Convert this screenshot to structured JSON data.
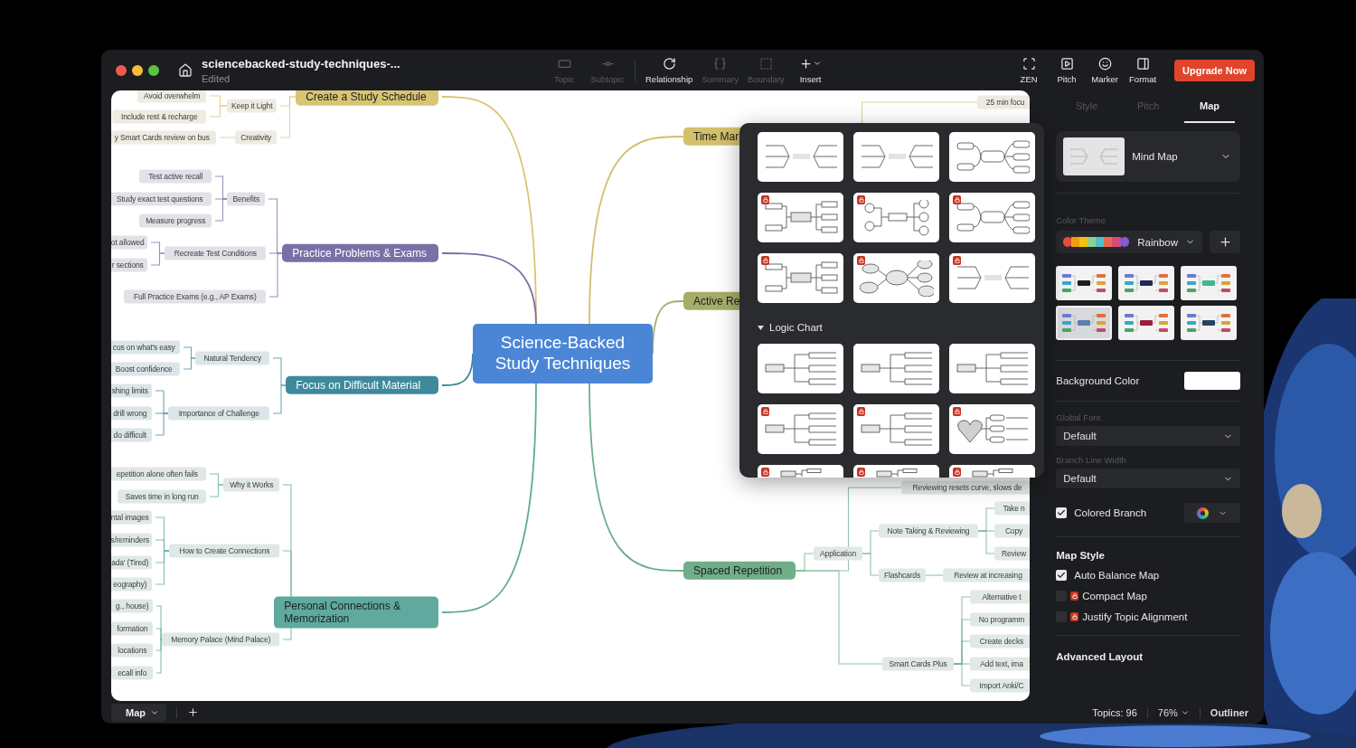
{
  "window": {
    "title": "sciencebacked-study-techniques-...",
    "subtitle": "Edited"
  },
  "toolbar": [
    {
      "label": "Topic",
      "disabled": true
    },
    {
      "label": "Subtopic",
      "disabled": true
    },
    {
      "label": "Relationship",
      "disabled": false
    },
    {
      "label": "Summary",
      "disabled": true
    },
    {
      "label": "Boundary",
      "disabled": true
    },
    {
      "label": "Insert",
      "disabled": false
    }
  ],
  "view_tools": [
    {
      "label": "ZEN"
    },
    {
      "label": "Pitch"
    },
    {
      "label": "Marker"
    },
    {
      "label": "Format"
    }
  ],
  "upgrade_button": "Upgrade Now",
  "map": {
    "topic": "Science-Backed Study Techniques",
    "branches": [
      {
        "text": "Create a Study Schedule",
        "color": "#d8c574",
        "children": [
          {
            "text": "Keep it Light",
            "children": [
              {
                "text": "Avoid overwhelm"
              },
              {
                "text": "Include rest & recharge"
              }
            ]
          },
          {
            "text": "Creativity",
            "children": [
              {
                "text": "y Smart Cards review on bus"
              }
            ]
          }
        ]
      },
      {
        "text": "Practice Problems & Exams",
        "color": "#7a6fa6",
        "children": [
          {
            "text": "Benefits",
            "children": [
              {
                "text": "Test active recall"
              },
              {
                "text": "Study exact test questions"
              },
              {
                "text": "Measure progress"
              }
            ]
          },
          {
            "text": "Recreate Test Conditions",
            "children": [
              {
                "text": "ot allowed"
              },
              {
                "text": "r sections"
              }
            ]
          },
          {
            "text": "Full Practice Exams (e.g., AP Exams)"
          }
        ]
      },
      {
        "text": "Focus on Difficult Material",
        "color": "#3e8a9c",
        "children": [
          {
            "text": "Natural Tendency",
            "children": [
              {
                "text": "cus on what's easy"
              },
              {
                "text": "Boost confidence"
              }
            ]
          },
          {
            "text": "Importance of Challenge",
            "children": [
              {
                "text": "shing limits"
              },
              {
                "text": "drill wrong"
              },
              {
                "text": "do difficult"
              }
            ]
          }
        ]
      },
      {
        "text": "Personal Connections & Memorization",
        "color": "#5fa99f",
        "children": [
          {
            "text": "Why it Works",
            "children": [
              {
                "text": "epetition alone often fails"
              },
              {
                "text": "Saves time in long run"
              }
            ]
          },
          {
            "text": "How to Create Connections",
            "children": [
              {
                "text": "ntal images"
              },
              {
                "text": "s/reminders"
              },
              {
                "text": "ada' (Tired)"
              },
              {
                "text": "eography)"
              }
            ]
          },
          {
            "text": "Memory Palace (Mind Palace)",
            "children": [
              {
                "text": "g., house)"
              },
              {
                "text": "formation"
              },
              {
                "text": "locations"
              },
              {
                "text": "ecall info"
              }
            ]
          }
        ]
      },
      {
        "text": "Time Mar",
        "color": "#d3bf6c",
        "children": [
          {
            "text": "25 min focu"
          }
        ]
      },
      {
        "text": "Active Re",
        "color": "#a6ac69"
      },
      {
        "text": "Spaced Repetition",
        "color": "#6fae89",
        "children": [
          {
            "text": "Reviewing resets curve, slows de"
          },
          {
            "text": "Application",
            "children": [
              {
                "text": "Note Taking & Reviewing",
                "children": [
                  {
                    "text": "Take n"
                  },
                  {
                    "text": "Copy"
                  },
                  {
                    "text": "Review"
                  }
                ]
              },
              {
                "text": "Flashcards",
                "children": [
                  {
                    "text": "Review at increasing"
                  }
                ]
              }
            ]
          },
          {
            "text": "Smart Cards Plus",
            "children": [
              {
                "text": "Alternative t"
              },
              {
                "text": "No programm"
              },
              {
                "text": "Create decks"
              },
              {
                "text": "Add text, ima"
              },
              {
                "text": "Import Anki/C"
              }
            ]
          }
        ]
      }
    ]
  },
  "layout_picker": {
    "thumbnails": [
      {
        "kind": "lines",
        "locked": false
      },
      {
        "kind": "lines",
        "locked": false
      },
      {
        "kind": "capsules",
        "locked": false
      },
      {
        "kind": "boxes",
        "locked": true
      },
      {
        "kind": "circles",
        "locked": true
      },
      {
        "kind": "capsules",
        "locked": true
      },
      {
        "kind": "boxes",
        "locked": true
      },
      {
        "kind": "ovals",
        "locked": true
      },
      {
        "kind": "lines",
        "locked": true
      }
    ],
    "sections": [
      {
        "title": "Logic Chart",
        "expanded": true,
        "thumbnails": [
          {
            "kind": "tree",
            "locked": false
          },
          {
            "kind": "tree",
            "locked": false
          },
          {
            "kind": "tree",
            "locked": false
          },
          {
            "kind": "tree",
            "locked": true
          },
          {
            "kind": "tree",
            "locked": true
          },
          {
            "kind": "heart",
            "locked": true
          },
          {
            "kind": "mini",
            "locked": true
          },
          {
            "kind": "mini",
            "locked": true
          },
          {
            "kind": "mini",
            "locked": true
          }
        ]
      }
    ]
  },
  "panel": {
    "tabs": [
      {
        "label": "Style",
        "selected": false
      },
      {
        "label": "Pitch",
        "selected": false
      },
      {
        "label": "Map",
        "selected": true
      }
    ],
    "structure": "Mind Map",
    "color_theme_label": "Color Theme",
    "color_theme": "Rainbow",
    "themes": [
      {
        "color": "#1d1d1f",
        "selected": false
      },
      {
        "color": "#23285a",
        "selected": false
      },
      {
        "color": "#3fb98a",
        "selected": false
      },
      {
        "color": "#5b7fb0",
        "selected": true
      },
      {
        "color": "#9b1d3a",
        "selected": false
      },
      {
        "color": "#26435e",
        "selected": false
      }
    ],
    "background_color_label": "Background Color",
    "global_font_label": "Global Font",
    "global_font": "Default",
    "branch_width_label": "Branch Line Width",
    "branch_width": "Default",
    "colored_branch": {
      "label": "Colored Branch",
      "checked": true
    },
    "map_style_title": "Map Style",
    "map_style": [
      {
        "label": "Auto Balance Map",
        "checked": true,
        "locked": false
      },
      {
        "label": "Compact Map",
        "checked": false,
        "locked": true
      },
      {
        "label": "Justify Topic Alignment",
        "checked": false,
        "locked": true
      }
    ],
    "advanced_title": "Advanced Layout"
  },
  "status_bar": {
    "sheet": "Map",
    "topics": "Topics: 96",
    "zoom": "76%",
    "outliner": "Outliner"
  }
}
